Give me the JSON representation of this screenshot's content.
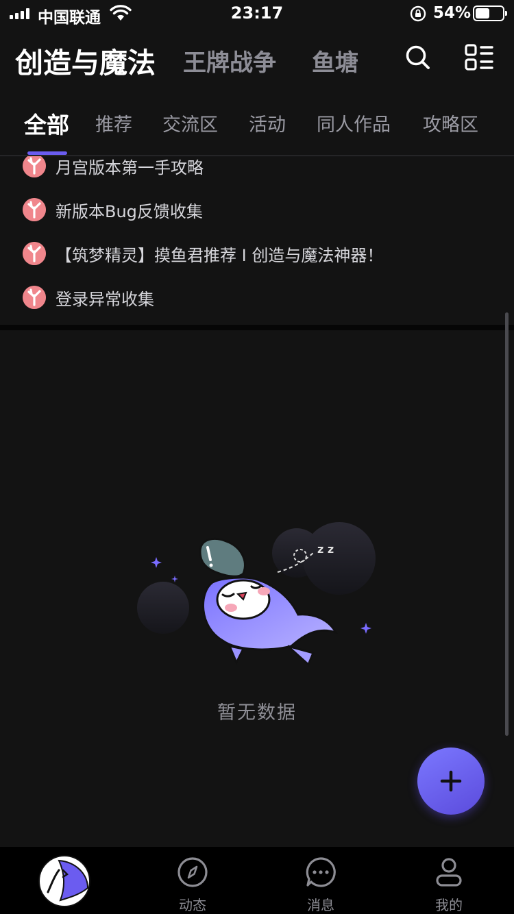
{
  "status_bar": {
    "carrier": "中国联通",
    "time": "23:17",
    "battery_percent": "54%",
    "battery_level": 0.54
  },
  "header": {
    "title": "创造与魔法",
    "tabs": [
      "王牌战争",
      "鱼塘"
    ],
    "icons": [
      "search-icon",
      "grid-menu-icon"
    ]
  },
  "categories": {
    "active_index": 0,
    "items": [
      "全部",
      "推荐",
      "交流区",
      "活动",
      "同人作品",
      "攻略区"
    ]
  },
  "notices": [
    "月宫版本第一手攻略",
    "新版本Bug反馈收集",
    "【筑梦精灵】摸鱼君推荐 I 创造与魔法神器！",
    "登录异常收集"
  ],
  "empty_state": {
    "text": "暂无数据",
    "illustration": "sleeping-mascot",
    "sleep_marks": "z z"
  },
  "fab": {
    "icon": "plus-icon"
  },
  "bottom_nav": {
    "items": [
      {
        "label": "",
        "icon": "home-avatar-icon"
      },
      {
        "label": "动态",
        "icon": "compass-icon"
      },
      {
        "label": "消息",
        "icon": "chat-bubble-icon"
      },
      {
        "label": "我的",
        "icon": "user-icon"
      }
    ]
  },
  "colors": {
    "background": "#131313",
    "accent": "#6a5cf0",
    "notice_icon": "#f0868c",
    "fab_gradient_start": "#7b78ff",
    "fab_gradient_end": "#5b4bdc"
  }
}
